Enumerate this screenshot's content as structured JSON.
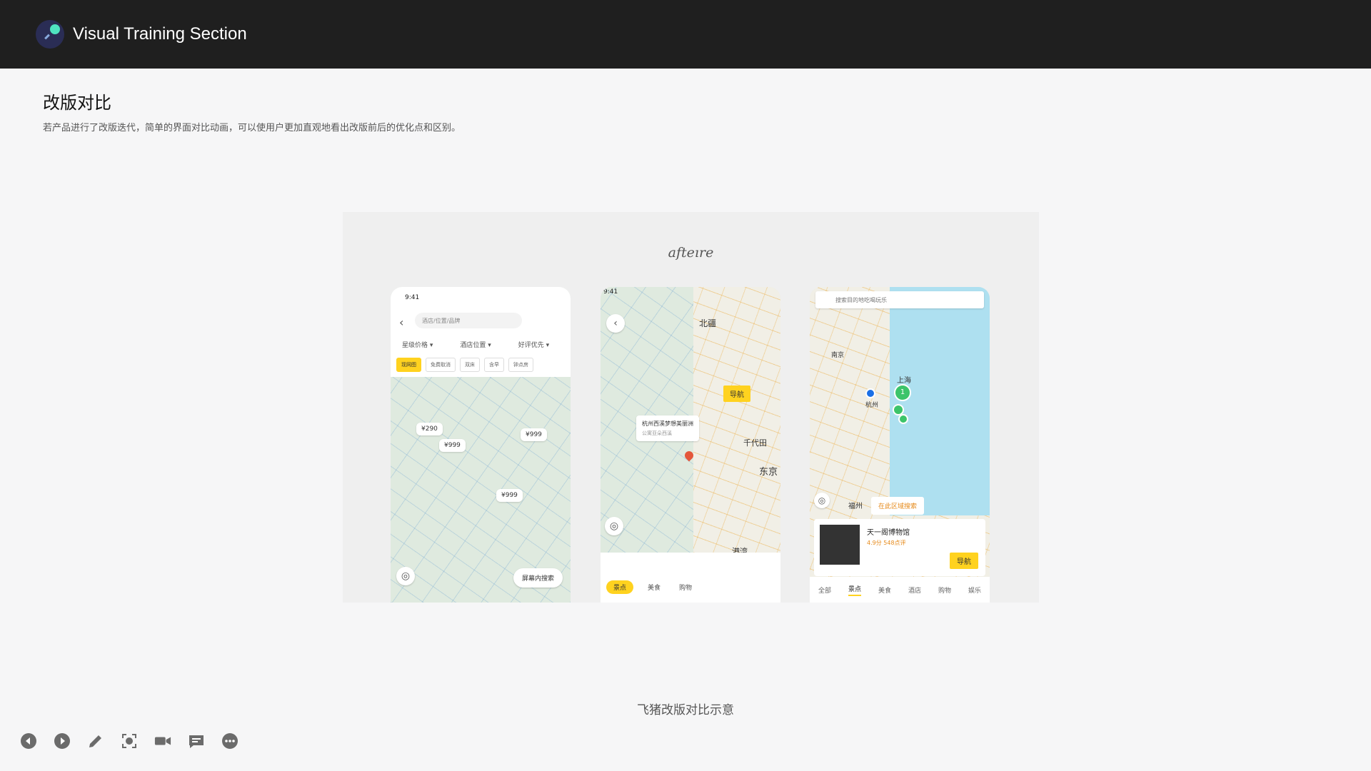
{
  "app": {
    "title": "Visual Training Section"
  },
  "section": {
    "title": "改版对比",
    "description": "若产品进行了改版迭代，简单的界面对比动画，可以使用户更加直观地看出改版前后的优化点和区别。"
  },
  "figure": {
    "heading": "afteıre",
    "caption": "飞猪改版对比示意",
    "phone1": {
      "time": "9:41",
      "search_placeholder": "酒店/位置/品牌",
      "filters": [
        "星级价格 ▾",
        "酒店位置 ▾",
        "好评优先 ▾"
      ],
      "chips": [
        "现网图",
        "免费取消",
        "双床",
        "含早",
        "钟点房"
      ],
      "prices": [
        "¥290",
        "¥999",
        "¥999",
        "¥999"
      ],
      "search_in_screen": "屏幕内搜索"
    },
    "phone2": {
      "time": "9:41",
      "nav_label": "导航",
      "hotel_name": "杭州西溪梦想美丽洲",
      "hotel_sub": "公寓亚朵西溪",
      "tabs": [
        "景点",
        "美食",
        "购物"
      ],
      "place_labels": [
        "北疆",
        "东京",
        "千代田",
        "港湾"
      ]
    },
    "phone3": {
      "search_placeholder": "搜索目的地吃喝玩乐",
      "cluster": "1",
      "area_search": "在此区域搜索",
      "poi_name": "天一阁博物馆",
      "poi_meta": "4.9分 548点评",
      "nav_label": "导航",
      "place_labels": [
        "南京",
        "上海",
        "杭州",
        "福州"
      ],
      "tabs": [
        "全部",
        "景点",
        "美食",
        "酒店",
        "购物",
        "娱乐"
      ]
    }
  },
  "toolbar": {
    "icons": [
      "prev-icon",
      "next-icon",
      "pencil-icon",
      "screenshot-icon",
      "video-icon",
      "comment-icon",
      "more-icon"
    ]
  },
  "colors": {
    "header_bg": "#1f1f1f",
    "accent_yellow": "#ffd21f",
    "logo_dot": "#4fe3c1"
  }
}
